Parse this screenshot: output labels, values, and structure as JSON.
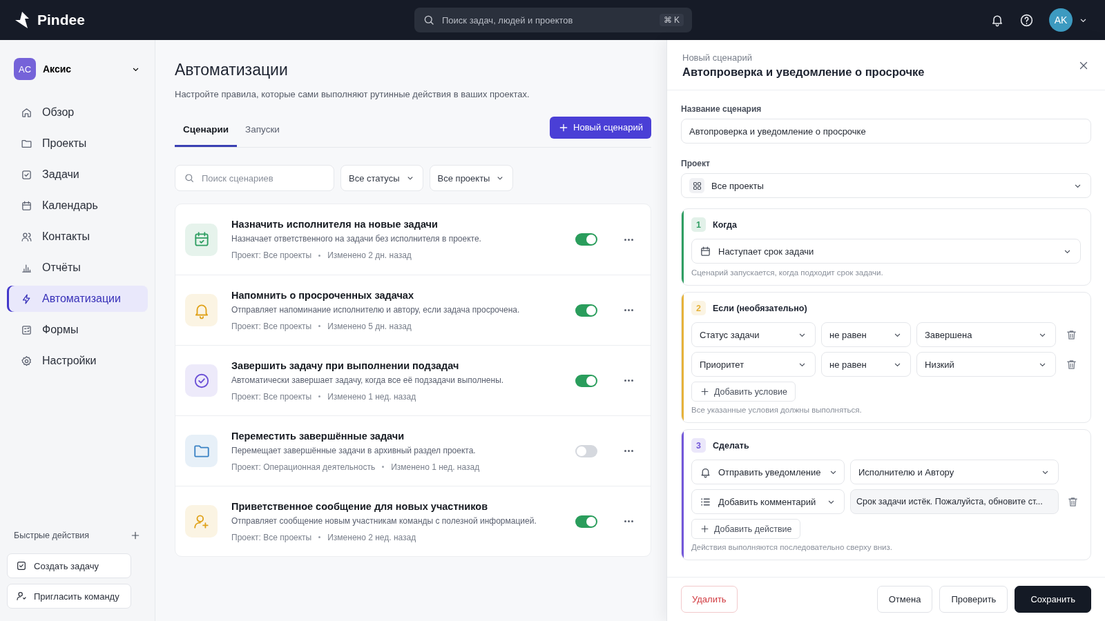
{
  "app": {
    "logo": "Pindee",
    "search": {
      "placeholder": "Поиск задач, людей и проектов",
      "shortcut": "⌘ K"
    },
    "avatar": "AK"
  },
  "workspace": {
    "badge": "AC",
    "name": "Аксис"
  },
  "sidebar": {
    "items": [
      {
        "label": "Обзор",
        "selected": false
      },
      {
        "label": "Проекты",
        "selected": false
      },
      {
        "label": "Задачи",
        "selected": false
      },
      {
        "label": "Календарь",
        "selected": false
      },
      {
        "label": "Контакты",
        "selected": false
      },
      {
        "label": "Отчёты",
        "selected": false
      },
      {
        "label": "Автоматизации",
        "selected": true
      },
      {
        "label": "Формы",
        "selected": false
      },
      {
        "label": "Настройки",
        "selected": false
      }
    ]
  },
  "quick_actions": {
    "title": "Быстрые действия",
    "items": [
      "Создать задачу",
      "Пригласить команду"
    ]
  },
  "page": {
    "title": "Автоматизации",
    "subtitle": "Настройте правила, которые сами выполняют рутинные действия в ваших проектах.",
    "tabs": [
      {
        "label": "Сценарии",
        "selected": true
      },
      {
        "label": "Запуски",
        "selected": false
      }
    ],
    "new_button": "Новый сценарий",
    "search": {
      "placeholder": "Поиск сценариев"
    },
    "filters": [
      "Все статусы",
      "Все проекты"
    ]
  },
  "scenarios": [
    {
      "color": "#2f9e62",
      "title": "Назначить исполнителя на новые задачи",
      "description": "Назначает ответственного на задачи без исполнителя в проекте.",
      "project": "Проект: Все проекты",
      "modified": "Изменено 2 дн. назад",
      "on": true
    },
    {
      "color": "#e0a21a",
      "title": "Напомнить о просроченных задачах",
      "description": "Отправляет напоминание исполнителю и автору, если задача просрочена.",
      "project": "Проект: Все проекты",
      "modified": "Изменено 5 дн. назад",
      "on": true
    },
    {
      "color": "#6a4fd6",
      "title": "Завершить задачу при выполнении подзадач",
      "description": "Автоматически завершает задачу, когда все её подзадачи выполнены.",
      "project": "Проект: Все проекты",
      "modified": "Изменено 1 нед. назад",
      "on": true
    },
    {
      "color": "#3a82c4",
      "title": "Переместить завершённые задачи",
      "description": "Перемещает завершённые задачи в архивный раздел проекта.",
      "project": "Проект: Операционная деятельность",
      "modified": "Изменено 1 нед. назад",
      "on": false
    },
    {
      "color": "#e0a21a",
      "title": "Приветственное сообщение для новых участников",
      "description": "Отправляет сообщение новым участникам команды с полезной информацией.",
      "project": "Проект: Все проекты",
      "modified": "Изменено 2 нед. назад",
      "on": true
    }
  ],
  "panel": {
    "eyebrow": "Новый сценарий",
    "title": "Автопроверка и уведомление о просрочке",
    "name_field": {
      "label": "Название сценария",
      "value": "Автопроверка и уведомление о просрочке"
    },
    "project_field": {
      "label": "Проект",
      "value": "Все проекты"
    },
    "steps": [
      {
        "kind": "trigger",
        "number": "1",
        "title": "Когда",
        "color": "#2f9e62",
        "rows": [
          {
            "fields": [
              {
                "kind": "select",
                "value": "Наступает срок задачи"
              }
            ]
          }
        ],
        "hint": "Сценарий запускается, когда подходит срок задачи."
      },
      {
        "kind": "conditions",
        "number": "2",
        "title": "Если (необязательно)",
        "color": "#e6b23a",
        "rows": [
          {
            "removable": true,
            "fields": [
              {
                "kind": "select",
                "value": "Статус задачи"
              },
              {
                "kind": "select",
                "value": "не равен"
              },
              {
                "kind": "select",
                "value": "Завершена"
              }
            ]
          },
          {
            "removable": true,
            "fields": [
              {
                "kind": "select",
                "value": "Приоритет"
              },
              {
                "kind": "select",
                "value": "не равен"
              },
              {
                "kind": "select",
                "value": "Низкий"
              }
            ]
          }
        ],
        "add_button": "Добавить условие",
        "hint": "Все указанные условия должны выполняться."
      },
      {
        "kind": "actions",
        "number": "3",
        "title": "Сделать",
        "color": "#7357d9",
        "rows": [
          {
            "removable": false,
            "fields": [
              {
                "kind": "select",
                "value": "Отправить уведомление"
              },
              {
                "kind": "select",
                "value": "Исполнителю и Автору"
              }
            ]
          },
          {
            "removable": true,
            "fields": [
              {
                "kind": "select",
                "value": "Добавить комментарий"
              },
              {
                "kind": "input",
                "value": "Срок задачи истёк. Пожалуйста, обновите ст..."
              }
            ]
          }
        ],
        "add_button": "Добавить действие",
        "hint": "Действия выполняются последовательно сверху вниз."
      }
    ],
    "buttons": {
      "delete": "Удалить",
      "cancel": "Отмена",
      "check": "Проверить",
      "save": "Сохранить"
    }
  }
}
